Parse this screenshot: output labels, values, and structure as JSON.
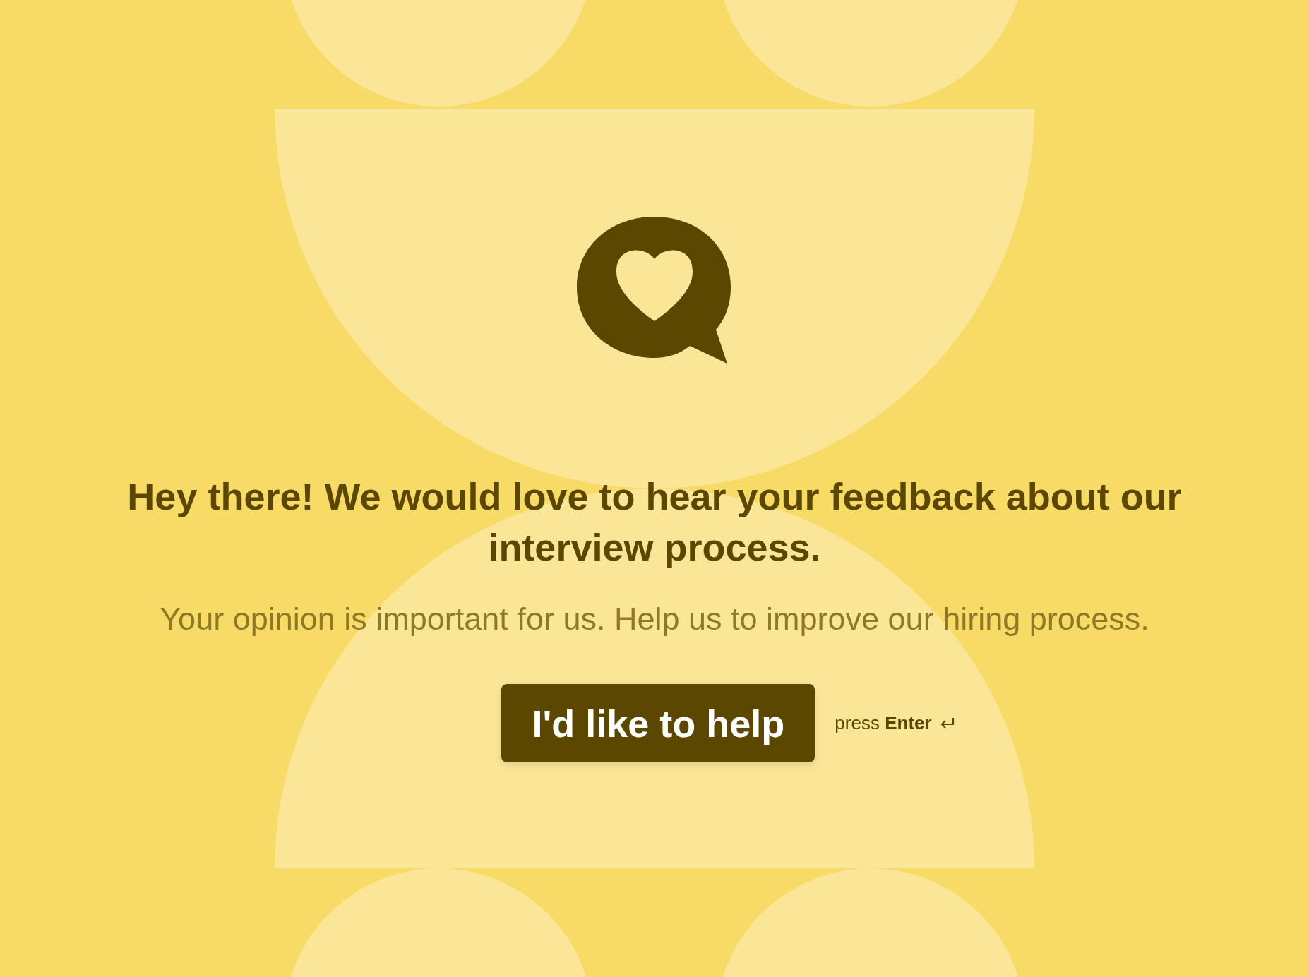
{
  "heading": "Hey there! We would love to hear your feedback about our interview process.",
  "subtitle": "Your opinion is important for us. Help us to improve our hiring process.",
  "button": {
    "label": "I'd like to help"
  },
  "hint": "press **Enter**"
}
